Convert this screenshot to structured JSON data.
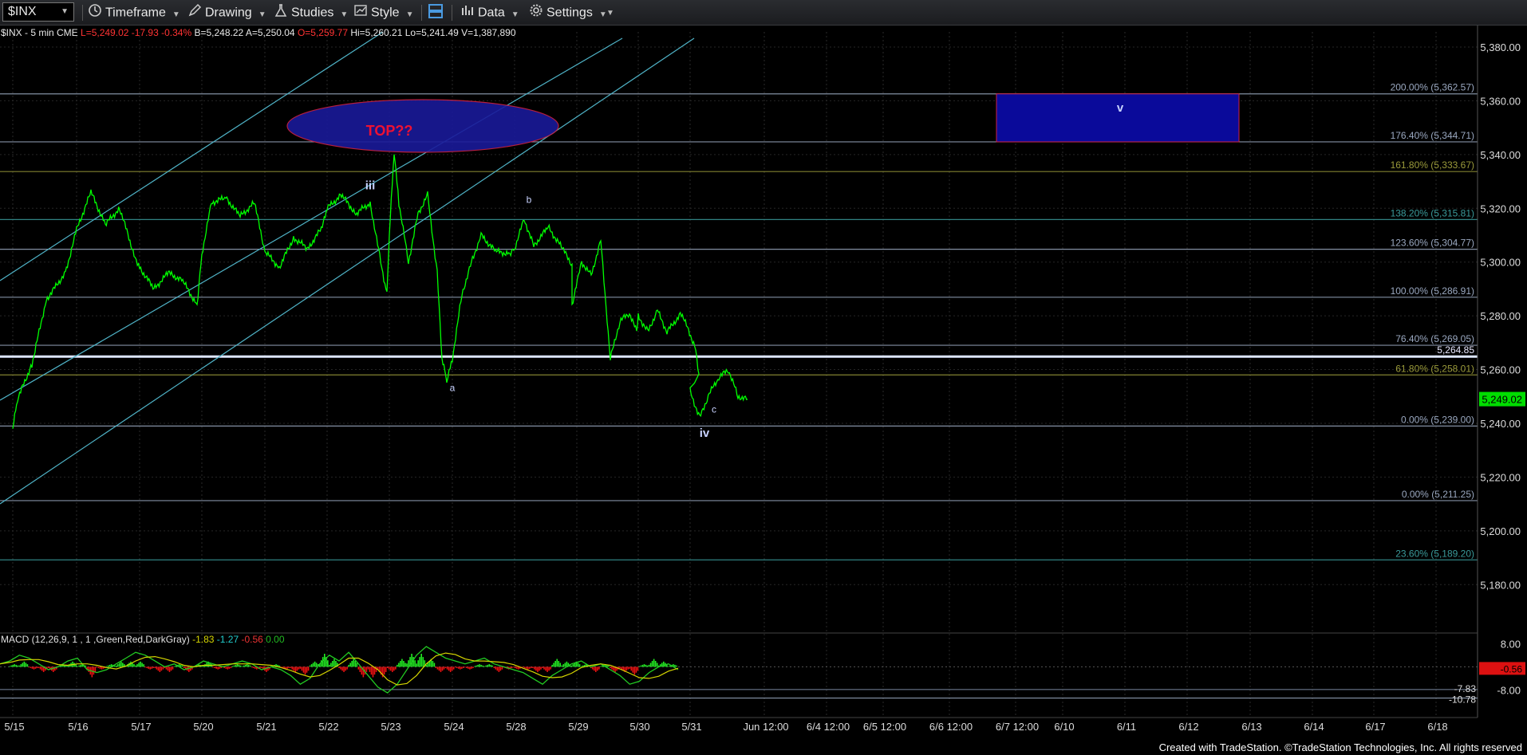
{
  "toolbar": {
    "symbol": "$INX",
    "timeframe": "Timeframe",
    "drawing": "Drawing",
    "studies": "Studies",
    "style": "Style",
    "data": "Data",
    "settings": "Settings"
  },
  "footer": "Created with TradeStation. ©TradeStation Technologies, Inc. All rights reserved",
  "colors": {
    "price": "#00ff00",
    "fib_line": "#9aa8c0",
    "channel": "#4fb3c7",
    "ellipse_fill": "#1a1a9a",
    "ellipse_stroke": "#cc2244",
    "target_box": "#0a0a9a",
    "macd_line": "#22cc22",
    "signal_line": "#d6d600",
    "hist_pos": "#22ee22",
    "hist_neg": "#ee1111"
  },
  "chart_data": {
    "type": "line",
    "header": {
      "symbol_line": "$INX - 5 min  CME",
      "last": "L=5,249.02",
      "change": "-17.93",
      "pct": "-0.34%",
      "bid": "B=5,248.22",
      "ask": "A=5,250.04",
      "open": "O=5,259.77",
      "high": "Hi=5,260.21",
      "low": "Lo=5,241.49",
      "volume": "V=1,387,890"
    },
    "ylim": [
      5170,
      5388
    ],
    "y_ticks": [
      "5,380.00",
      "5,360.00",
      "5,340.00",
      "5,320.00",
      "5,300.00",
      "5,280.00",
      "5,260.00",
      "5,240.00",
      "5,220.00",
      "5,200.00",
      "5,180.00"
    ],
    "x_ticks": [
      "5/15",
      "5/16",
      "5/17",
      "5/20",
      "5/21",
      "5/22",
      "5/23",
      "5/24",
      "5/28",
      "5/29",
      "5/30",
      "5/31",
      "Jun 12:00",
      "6/4 12:00",
      "6/5 12:00",
      "6/6 12:00",
      "6/7 12:00",
      "6/10",
      "6/11",
      "6/12",
      "6/13",
      "6/14",
      "6/17",
      "6/18"
    ],
    "last_price_label": "5,249.02",
    "price_series": [
      [
        "5/15 09:30",
        5238
      ],
      [
        "5/15 10:00",
        5249
      ],
      [
        "5/15 11:30",
        5262
      ],
      [
        "5/15 13:00",
        5286
      ],
      [
        "5/15 15:00",
        5296
      ],
      [
        "5/16 09:30",
        5312
      ],
      [
        "5/16 11:00",
        5326
      ],
      [
        "5/16 12:30",
        5314
      ],
      [
        "5/16 14:00",
        5320
      ],
      [
        "5/16 15:30",
        5303
      ],
      [
        "5/17 09:30",
        5298
      ],
      [
        "5/17 11:00",
        5290
      ],
      [
        "5/17 12:30",
        5296
      ],
      [
        "5/17 14:00",
        5293
      ],
      [
        "5/17 15:30",
        5284
      ],
      [
        "5/20 09:30",
        5303
      ],
      [
        "5/20 10:30",
        5322
      ],
      [
        "5/20 12:00",
        5324
      ],
      [
        "5/20 13:30",
        5317
      ],
      [
        "5/20 15:00",
        5322
      ],
      [
        "5/21 09:30",
        5304
      ],
      [
        "5/21 11:00",
        5298
      ],
      [
        "5/21 12:30",
        5309
      ],
      [
        "5/21 14:00",
        5305
      ],
      [
        "5/21 15:30",
        5313
      ],
      [
        "5/22 09:30",
        5320
      ],
      [
        "5/22 11:00",
        5325
      ],
      [
        "5/22 12:30",
        5318
      ],
      [
        "5/22 14:00",
        5322
      ],
      [
        "5/22 15:00",
        5302
      ],
      [
        "5/22 15:45",
        5288
      ],
      [
        "5/23 09:30",
        5310
      ],
      [
        "5/23 10:00",
        5341
      ],
      [
        "5/23 10:30",
        5322
      ],
      [
        "5/23 11:30",
        5300
      ],
      [
        "5/23 12:30",
        5318
      ],
      [
        "5/23 13:30",
        5325
      ],
      [
        "5/23 14:30",
        5296
      ],
      [
        "5/23 15:00",
        5264
      ],
      [
        "5/23 15:30",
        5256
      ],
      [
        "5/24 09:30",
        5264
      ],
      [
        "5/24 10:30",
        5288
      ],
      [
        "5/24 11:30",
        5300
      ],
      [
        "5/24 12:30",
        5310
      ],
      [
        "5/24 14:00",
        5304
      ],
      [
        "5/24 15:30",
        5303
      ],
      [
        "5/28 09:30",
        5305
      ],
      [
        "5/28 10:30",
        5316
      ],
      [
        "5/28 11:30",
        5306
      ],
      [
        "5/28 13:00",
        5313
      ],
      [
        "5/28 14:30",
        5305
      ],
      [
        "5/28 15:30",
        5299
      ],
      [
        "5/29 09:00",
        5284
      ],
      [
        "5/29 10:00",
        5300
      ],
      [
        "5/29 11:00",
        5295
      ],
      [
        "5/29 12:00",
        5308
      ],
      [
        "5/29 13:00",
        5264
      ],
      [
        "5/29 14:00",
        5278
      ],
      [
        "5/29 15:00",
        5281
      ],
      [
        "5/29 15:45",
        5274
      ],
      [
        "5/30 09:30",
        5280
      ],
      [
        "5/30 10:30",
        5274
      ],
      [
        "5/30 11:30",
        5282
      ],
      [
        "5/30 12:30",
        5274
      ],
      [
        "5/30 14:00",
        5281
      ],
      [
        "5/30 15:30",
        5268
      ],
      [
        "5/30 15:50",
        5258
      ],
      [
        "5/31 09:30",
        5252
      ],
      [
        "5/31 10:30",
        5242
      ],
      [
        "5/31 11:30",
        5251
      ],
      [
        "5/31 12:30",
        5257
      ],
      [
        "5/31 13:30",
        5260
      ],
      [
        "5/31 14:30",
        5250
      ],
      [
        "5/31 15:30",
        5249
      ]
    ],
    "fib_levels": [
      {
        "label": "200.00% (5,362.57)",
        "value": 5362.57,
        "color": "#9aa8c0"
      },
      {
        "label": "176.40% (5,344.71)",
        "value": 5344.71,
        "color": "#9aa8c0"
      },
      {
        "label": "161.80% (5,333.67)",
        "value": 5333.67,
        "color": "#9a9a3a"
      },
      {
        "label": "138.20% (5,315.81)",
        "value": 5315.81,
        "color": "#3a9a9a"
      },
      {
        "label": "123.60% (5,304.77)",
        "value": 5304.77,
        "color": "#9aa8c0"
      },
      {
        "label": "100.00% (5,286.91)",
        "value": 5286.91,
        "color": "#9aa8c0"
      },
      {
        "label": "76.40% (5,269.05)",
        "value": 5269.05,
        "color": "#9aa8c0"
      },
      {
        "label": "61.80% (5,258.01)",
        "value": 5258.01,
        "color": "#9a9a3a"
      },
      {
        "label": "0.00% (5,239.00)",
        "value": 5239.0,
        "color": "#9aa8c0"
      },
      {
        "label": "0.00% (5,211.25)",
        "value": 5211.25,
        "color": "#9aa8c0"
      },
      {
        "label": "23.60% (5,189.20)",
        "value": 5189.2,
        "color": "#3a9a9a"
      }
    ],
    "horizontal_level": {
      "label": "5,264.85",
      "value": 5264.85
    },
    "wave_labels": [
      {
        "text": "iii",
        "x": "5/22 14:00",
        "y": 5327
      },
      {
        "text": "TOP??",
        "x": "5/23 09:30",
        "y": 5347
      },
      {
        "text": "a",
        "x": "5/24 09:30",
        "y": 5252
      },
      {
        "text": "b",
        "x": "5/28 11:00",
        "y": 5322
      },
      {
        "text": "c",
        "x": "5/31 12:00",
        "y": 5244
      },
      {
        "text": "iv",
        "x": "5/31 11:00",
        "y": 5235
      },
      {
        "text": "v",
        "x": "6/11 09:00",
        "y": 5356
      }
    ],
    "macd": {
      "label": "MACD (12,26,9, 1 , 1 ,Green,Red,DarkGray)",
      "values": [
        "-1.83",
        "-1.27",
        "-0.56",
        "0.00"
      ],
      "ylim": [
        -12,
        10
      ],
      "y_ticks": [
        "8.00",
        "-8.00"
      ],
      "last_labels": [
        "-0.56",
        "-7.83",
        "-10.78"
      ],
      "series": [
        1,
        2,
        4,
        3,
        1,
        -1,
        0,
        2,
        3,
        -1,
        -2,
        -1,
        1,
        3,
        5,
        4,
        2,
        0,
        1,
        -1,
        0,
        2,
        1,
        0,
        1,
        2,
        1,
        -1,
        0,
        -1,
        -3,
        -6,
        -4,
        1,
        4,
        2,
        5,
        1,
        -3,
        -7,
        -9,
        -6,
        -1,
        4,
        7,
        5,
        3,
        2,
        1,
        2,
        3,
        1,
        0,
        -1,
        -2,
        -4,
        -6,
        -3,
        -1,
        1,
        2,
        0,
        1,
        -1,
        -3,
        -6,
        -5,
        -2,
        0,
        1,
        -1
      ]
    }
  }
}
